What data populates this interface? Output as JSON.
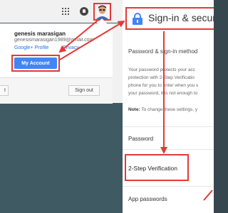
{
  "account_popup": {
    "name": "genesis marasigan",
    "email": "genesismarasigan1989@gmail.com",
    "google_plus_profile": "Google+ Profile",
    "privacy": "Privacy",
    "my_account_button": "My Account",
    "add_account_button": "t",
    "sign_out_button": "Sign out"
  },
  "topbar": {
    "icons": [
      "apps-icon",
      "notifications-icon",
      "avatar"
    ]
  },
  "security_panel": {
    "title": "Sign-in & secur",
    "password_heading": "Password & sign-in method",
    "description_lines": [
      "Your password protects your acc",
      "protection with 2-Step Verificatio",
      "phone for you to enter when you s",
      "your password, it is not enough to"
    ],
    "note_label": "Note:",
    "note_text": "To change these settings, y",
    "password_row": "Password",
    "two_step_row": "2-Step Verification",
    "app_passwords_row": "App passwords"
  },
  "colors": {
    "highlight": "#e53935",
    "brand_blue": "#4285f4",
    "link_blue": "#1a73e8",
    "background": "#37474f"
  }
}
